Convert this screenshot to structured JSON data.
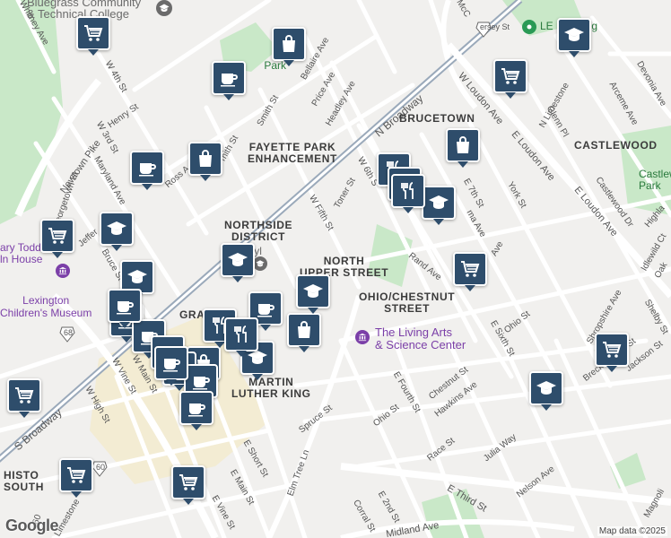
{
  "map": {
    "attribution": "Map data ©2025",
    "logo": "Google"
  },
  "colors": {
    "pin": "#2e4d6b",
    "park": "#c9e8c8",
    "road": "#ffffff",
    "arterial": "#9aa9ba",
    "poi_purple": "#7b3fa8",
    "downtown": "#f3e9c8"
  },
  "neighborhoods": [
    {
      "id": "brucetown",
      "text": "BRUCETOWN"
    },
    {
      "id": "castlewood",
      "text": "CASTLEWOOD"
    },
    {
      "id": "fayette-park",
      "text": "FAYETTE PARK\nENHANCEMENT"
    },
    {
      "id": "northside",
      "text": "NORTHSIDE\nDISTRICT"
    },
    {
      "id": "north-upper",
      "text": "NORTH\nUPPER STREET"
    },
    {
      "id": "ohio-chestnut",
      "text": "OHIO/CHESTNUT\nSTREET"
    },
    {
      "id": "mlk",
      "text": "MARTIN\nLUTHER KING"
    },
    {
      "id": "historic-south",
      "text": "HISTO\nSOUTH"
    },
    {
      "id": "gra",
      "text": "GRA"
    }
  ],
  "pois": [
    {
      "id": "bluegrass",
      "text": "Bluegrass Community\n& Technical College"
    },
    {
      "id": "living-arts",
      "text": "The Living Arts\n& Science Center"
    },
    {
      "id": "mary-todd",
      "text": "ary Todd\nln House"
    },
    {
      "id": "childrens",
      "text": "Lexington\nChildren's Museum"
    },
    {
      "id": "transy",
      "text": "Transyl\nUnive"
    },
    {
      "id": "coolavin",
      "text": "Co         Park"
    },
    {
      "id": "castlewood-park",
      "text": "Castlewo\nPark"
    },
    {
      "id": "le-bing",
      "text": "LE        bing"
    }
  ],
  "streets": [
    {
      "id": "n-broadway",
      "text": "N Broadway"
    },
    {
      "id": "s-broadway",
      "text": "S Broadway"
    },
    {
      "id": "w-loudon",
      "text": "W Loudon Ave"
    },
    {
      "id": "e-loudon",
      "text": "E Loudon Ave"
    },
    {
      "id": "e-loudon2",
      "text": "E Loudon Ave"
    },
    {
      "id": "newtown",
      "text": "Newtown Pike"
    },
    {
      "id": "whitney",
      "text": "Whitney Ave"
    },
    {
      "id": "w4th",
      "text": "W 4th St"
    },
    {
      "id": "w3rd",
      "text": "W 3rd St"
    },
    {
      "id": "henry",
      "text": "Henry St"
    },
    {
      "id": "maryland",
      "text": "Maryland Ave"
    },
    {
      "id": "georgetown",
      "text": "Georgetown St"
    },
    {
      "id": "jeffer",
      "text": "Jeffer"
    },
    {
      "id": "bruce",
      "text": "Bruce St"
    },
    {
      "id": "ross",
      "text": "Ross A"
    },
    {
      "id": "smith",
      "text": "Smith St"
    },
    {
      "id": "smith2",
      "text": "mith St"
    },
    {
      "id": "bellaire",
      "text": "Bellaire Ave"
    },
    {
      "id": "price",
      "text": "Price Ave"
    },
    {
      "id": "headley",
      "text": "Headley Ave"
    },
    {
      "id": "w6th",
      "text": "W 6th S"
    },
    {
      "id": "toner",
      "text": "Toner St"
    },
    {
      "id": "wfifth",
      "text": "W Fifth St"
    },
    {
      "id": "e7th",
      "text": "E 7th St"
    },
    {
      "id": "ma-ave",
      "text": "ma Ave"
    },
    {
      "id": "york",
      "text": "York St"
    },
    {
      "id": "n-limestone",
      "text": "N Limestone"
    },
    {
      "id": "glenn",
      "text": "Glenn Pl"
    },
    {
      "id": "arceme",
      "text": "Arceme Ave"
    },
    {
      "id": "devonia",
      "text": "Devonia Ave"
    },
    {
      "id": "castlewood-dr",
      "text": "Castlewood Dr"
    },
    {
      "id": "highla",
      "text": "Highla"
    },
    {
      "id": "idlewild",
      "text": "Idlewild Ct"
    },
    {
      "id": "oak",
      "text": "Oak"
    },
    {
      "id": "rand",
      "text": "Rand Ave"
    },
    {
      "id": "ave-lbl",
      "text": "Ave"
    },
    {
      "id": "ohio1",
      "text": "Ohio St"
    },
    {
      "id": "e-sixth",
      "text": "E Sixth St"
    },
    {
      "id": "shropshire",
      "text": "Shropshire Ave"
    },
    {
      "id": "shelby",
      "text": "Shelby St"
    },
    {
      "id": "breckenridge",
      "text": "Breckenridge St"
    },
    {
      "id": "jackson",
      "text": "Jackson St"
    },
    {
      "id": "e-fourth",
      "text": "E Fourth St"
    },
    {
      "id": "chestnut",
      "text": "Chestnut St"
    },
    {
      "id": "hawkins",
      "text": "Hawkins Ave"
    },
    {
      "id": "ohio2",
      "text": "Ohio St"
    },
    {
      "id": "race",
      "text": "Race St"
    },
    {
      "id": "julia",
      "text": "Julia Way"
    },
    {
      "id": "nelson",
      "text": "Nelson Ave"
    },
    {
      "id": "e-third",
      "text": "E Third St"
    },
    {
      "id": "magnolia",
      "text": "Magnoli"
    },
    {
      "id": "spruce",
      "text": "Spruce St"
    },
    {
      "id": "elm-tree",
      "text": "Elm Tree Ln"
    },
    {
      "id": "corral",
      "text": "Corral St"
    },
    {
      "id": "e2nd",
      "text": "E 2nd St"
    },
    {
      "id": "midland",
      "text": "Midland Ave"
    },
    {
      "id": "e-short",
      "text": "E Short St"
    },
    {
      "id": "e-main",
      "text": "E Main St"
    },
    {
      "id": "e-vine",
      "text": "E Vine St"
    },
    {
      "id": "w-main",
      "text": "W Main St"
    },
    {
      "id": "w-vine",
      "text": "W Vine St"
    },
    {
      "id": "w-high",
      "text": "W High St"
    },
    {
      "id": "mcc",
      "text": "McC"
    },
    {
      "id": "limestone-s",
      "text": "Limestone"
    },
    {
      "id": "mersey",
      "text": "ersey St"
    },
    {
      "id": "route68",
      "text": "68"
    },
    {
      "id": "route60a",
      "text": "60"
    },
    {
      "id": "route60b",
      "text": "60"
    }
  ],
  "markers": [
    {
      "icon": "cart-icon"
    },
    {
      "icon": "cart-icon"
    },
    {
      "icon": "cart-icon"
    },
    {
      "icon": "cart-icon"
    },
    {
      "icon": "cart-icon"
    },
    {
      "icon": "cart-icon"
    },
    {
      "icon": "cart-icon"
    },
    {
      "icon": "cart-icon"
    },
    {
      "icon": "bag-icon"
    },
    {
      "icon": "bag-icon"
    },
    {
      "icon": "bag-icon"
    },
    {
      "icon": "bag-icon"
    },
    {
      "icon": "bag-icon"
    },
    {
      "icon": "coffee-icon"
    },
    {
      "icon": "coffee-icon"
    },
    {
      "icon": "coffee-icon"
    },
    {
      "icon": "coffee-icon"
    },
    {
      "icon": "coffee-icon"
    },
    {
      "icon": "coffee-icon"
    },
    {
      "icon": "coffee-icon"
    },
    {
      "icon": "school-icon"
    },
    {
      "icon": "school-icon"
    },
    {
      "icon": "school-icon"
    },
    {
      "icon": "school-icon"
    },
    {
      "icon": "school-icon"
    },
    {
      "icon": "school-icon"
    },
    {
      "icon": "school-icon"
    },
    {
      "icon": "school-icon"
    },
    {
      "icon": "restaurant-icon"
    },
    {
      "icon": "restaurant-icon"
    },
    {
      "icon": "restaurant-icon"
    },
    {
      "icon": "restaurant-icon"
    },
    {
      "icon": "restaurant-icon"
    },
    {
      "icon": "coffee-icon"
    },
    {
      "icon": "coffee-icon"
    },
    {
      "icon": "coffee-icon"
    },
    {
      "icon": "coffee-icon"
    }
  ]
}
